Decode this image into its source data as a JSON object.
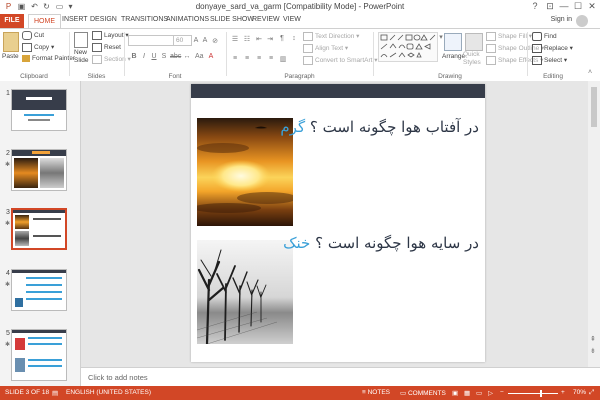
{
  "app": {
    "document_title": "donyaye_sard_va_garm [Compatibility Mode] - PowerPoint"
  },
  "window": {
    "help": "?",
    "restore_ribbon": "⊡",
    "minimize": "—",
    "maximize": "☐",
    "close": "✕"
  },
  "ribbon_tabs": [
    "FILE",
    "HOME",
    "INSERT",
    "DESIGN",
    "TRANSITIONS",
    "ANIMATIONS",
    "SLIDE SHOW",
    "REVIEW",
    "VIEW"
  ],
  "signin": "Sign in",
  "ribbon": {
    "clipboard": {
      "label": "Clipboard",
      "paste": "Paste",
      "cut": "Cut",
      "copy": "Copy",
      "format_painter": "Format Painter"
    },
    "slides": {
      "label": "Slides",
      "new_slide": "New Slide",
      "layout": "Layout",
      "reset": "Reset",
      "section": "Section"
    },
    "font": {
      "label": "Font",
      "size": "60"
    },
    "paragraph": {
      "label": "Paragraph",
      "text_direction": "Text Direction",
      "align_text": "Align Text",
      "convert_smartart": "Convert to SmartArt"
    },
    "drawing": {
      "label": "Drawing",
      "arrange": "Arrange",
      "quick_styles": "Quick Styles",
      "shape_fill": "Shape Fill",
      "shape_outline": "Shape Outline",
      "shape_effects": "Shape Effects"
    },
    "editing": {
      "label": "Editing",
      "find": "Find",
      "replace": "Replace",
      "select": "Select"
    }
  },
  "thumbnails": [
    {
      "number": "1"
    },
    {
      "number": "2"
    },
    {
      "number": "3",
      "selected": true
    },
    {
      "number": "4"
    },
    {
      "number": "5"
    }
  ],
  "slide": {
    "line1_main": "در آفتاب هوا چگونه است ؟",
    "line1_highlight": "گرم",
    "line2_main": "در سایه هوا چگونه است ؟",
    "line2_highlight": "خنک",
    "highlight_color": "#3aa0d8"
  },
  "notes_placeholder": "Click to add notes",
  "status": {
    "slide_info": "SLIDE 3 OF 18",
    "language": "ENGLISH (UNITED STATES)",
    "notes": "NOTES",
    "comments": "COMMENTS",
    "zoom": "70%"
  },
  "colors": {
    "accent": "#d24726",
    "slide_band": "#373d4a"
  }
}
